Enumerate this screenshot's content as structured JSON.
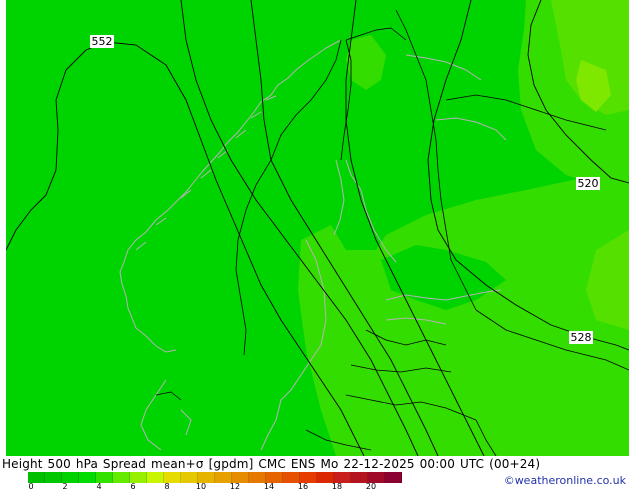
{
  "map": {
    "contours": [
      {
        "label": "552"
      },
      {
        "label": "520"
      },
      {
        "label": "528"
      }
    ],
    "colors": {
      "base": "#00d400",
      "light": "#33dd00",
      "lighter": "#55e000",
      "lightest": "#7ee800",
      "coast": "#b4b4b4",
      "border": "#000000"
    }
  },
  "footer": {
    "title": "Height 500 hPa Spread mean+σ [gpdm] CMC ENS Mo 22-12-2025 00:00 UTC (00+24)",
    "credit": "©weatheronline.co.uk",
    "colorbar": {
      "colors": [
        "#00be00",
        "#00c800",
        "#00d200",
        "#00dc00",
        "#32e100",
        "#64eb00",
        "#96f000",
        "#c8f500",
        "#e6dc00",
        "#e6c800",
        "#e6b400",
        "#e6a000",
        "#e68c00",
        "#e67800",
        "#e66400",
        "#e65000",
        "#e63c00",
        "#dc2800",
        "#c81e1e",
        "#b4141e",
        "#a00a28",
        "#8c0032"
      ],
      "ticks": [
        "0",
        "2",
        "4",
        "6",
        "8",
        "10",
        "12",
        "14",
        "16",
        "18",
        "20"
      ]
    }
  }
}
